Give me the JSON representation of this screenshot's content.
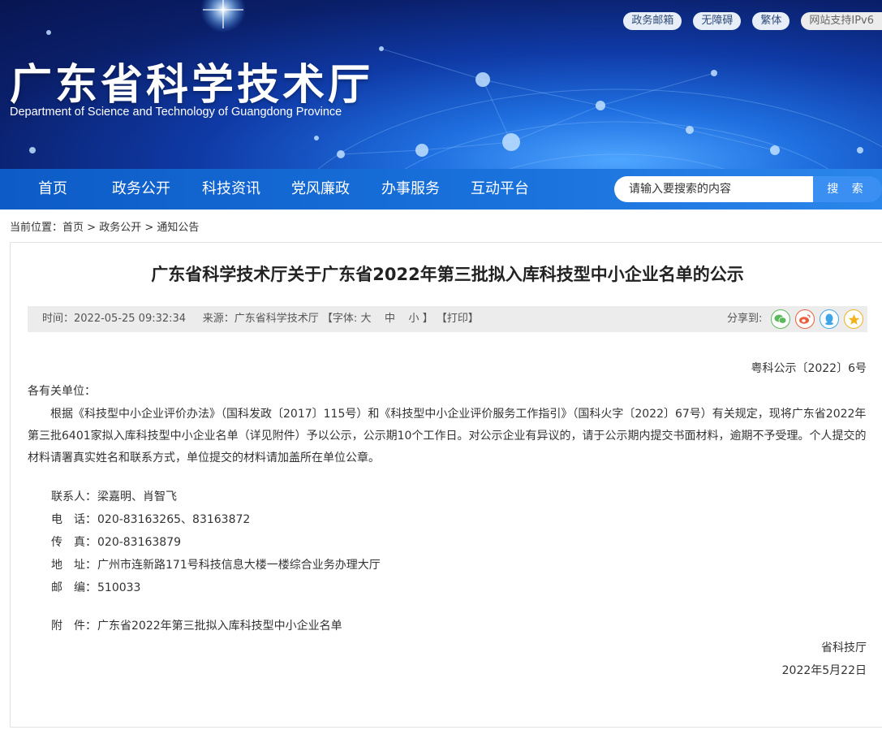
{
  "header": {
    "title": "广东省科学技术厅",
    "subtitle": "Department of Science and Technology of Guangdong Province",
    "top_links": [
      "政务邮箱",
      "无障碍",
      "繁体",
      "网站支持IPv6"
    ]
  },
  "nav": {
    "items": [
      "首页",
      "政务公开",
      "科技资讯",
      "党风廉政",
      "办事服务",
      "互动平台"
    ],
    "search_placeholder": "请输入要搜索的内容",
    "search_button": "搜 索"
  },
  "breadcrumb": {
    "prefix": "当前位置：",
    "items": [
      "首页",
      "政务公开",
      "通知公告"
    ],
    "sep": " > "
  },
  "article": {
    "title": "广东省科学技术厅关于广东省2022年第三批拟入库科技型中小企业名单的公示",
    "meta": {
      "time": "时间：2022-05-25 09:32:34",
      "source": "来源：广东省科学技术厅",
      "font_label": "【字体:",
      "font_sizes": [
        "大",
        "中",
        "小"
      ],
      "font_close": "】",
      "print": "【打印】",
      "share_label": "分享到:"
    },
    "share_icons": [
      "wechat-icon",
      "weibo-icon",
      "qq-icon",
      "qzone-icon"
    ],
    "doc_number": "粤科公示〔2022〕6号",
    "salutation": "各有关单位：",
    "body": "根据《科技型中小企业评价办法》（国科发政〔2017〕115号）和《科技型中小企业评价服务工作指引》（国科火字〔2022〕67号）有关规定，现将广东省2022年第三批6401家拟入库科技型中小企业名单（详见附件）予以公示，公示期10个工作日。对公示企业有异议的，请于公示期内提交书面材料，逾期不予受理。个人提交的材料请署真实姓名和联系方式，单位提交的材料请加盖所在单位公章。",
    "contacts": [
      {
        "label": "联系人：",
        "value": "梁嘉明、肖智飞"
      },
      {
        "label": "电　话：",
        "value": "020-83163265、83163872"
      },
      {
        "label": "传　真：",
        "value": "020-83163879"
      },
      {
        "label": "地　址：",
        "value": "广州市连新路171号科技信息大楼一楼综合业务办理大厅"
      },
      {
        "label": "邮　编：",
        "value": "510033"
      }
    ],
    "attachment": {
      "label": "附　件：",
      "value": "广东省2022年第三批拟入库科技型中小企业名单"
    },
    "signature": "省科技厅",
    "date": "2022年5月22日"
  },
  "colors": {
    "nav_blue": "#1a6fdc",
    "search_button": "#3b8ff2",
    "meta_bg": "#ececec"
  }
}
